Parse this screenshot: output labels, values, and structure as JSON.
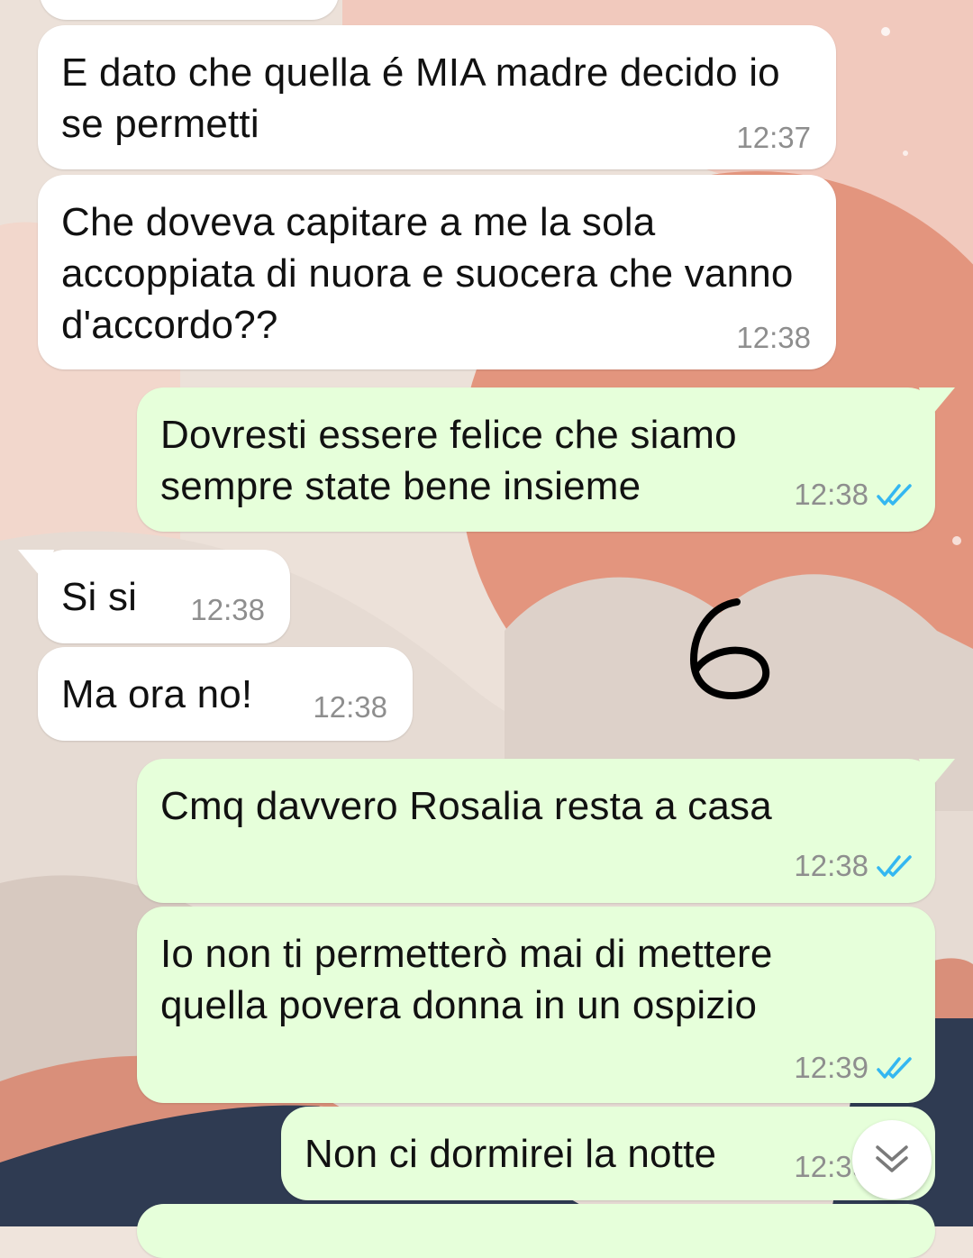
{
  "messages": [
    {
      "id": "m1",
      "dir": "in",
      "text": "E dato che quella é MIA madre decido io se permetti",
      "time": "12:37"
    },
    {
      "id": "m2",
      "dir": "in",
      "text": "Che doveva capitare a me la sola accoppiata di nuora e suocera che vanno d'accordo??",
      "time": "12:38"
    },
    {
      "id": "m3",
      "dir": "out",
      "text": "Dovresti essere felice che siamo sempre state bene insieme",
      "time": "12:38",
      "status": "read"
    },
    {
      "id": "m4",
      "dir": "in",
      "text": "Si si",
      "time": "12:38"
    },
    {
      "id": "m5",
      "dir": "in",
      "text": "Ma ora no!",
      "time": "12:38"
    },
    {
      "id": "m6",
      "dir": "out",
      "text": "Cmq davvero Rosalia resta a casa",
      "time": "12:38",
      "status": "read"
    },
    {
      "id": "m7",
      "dir": "out",
      "text": "Io non ti permetterò mai di mettere quella povera donna in un ospizio",
      "time": "12:39",
      "status": "read"
    },
    {
      "id": "m8",
      "dir": "out",
      "text": "Non ci dormirei la notte",
      "time": "12:39",
      "status": "read"
    }
  ],
  "annotation": "6",
  "colors": {
    "incoming_bubble": "#ffffff",
    "outgoing_bubble": "#e6ffda",
    "read_ticks": "#34b7f1",
    "timestamp": "#8e8e8e",
    "wallpaper_peach": "#e49a82",
    "wallpaper_navy": "#2f3b52"
  },
  "icons": {
    "read_receipt": "double-check-icon",
    "scroll_down": "double-chevron-down-icon"
  }
}
